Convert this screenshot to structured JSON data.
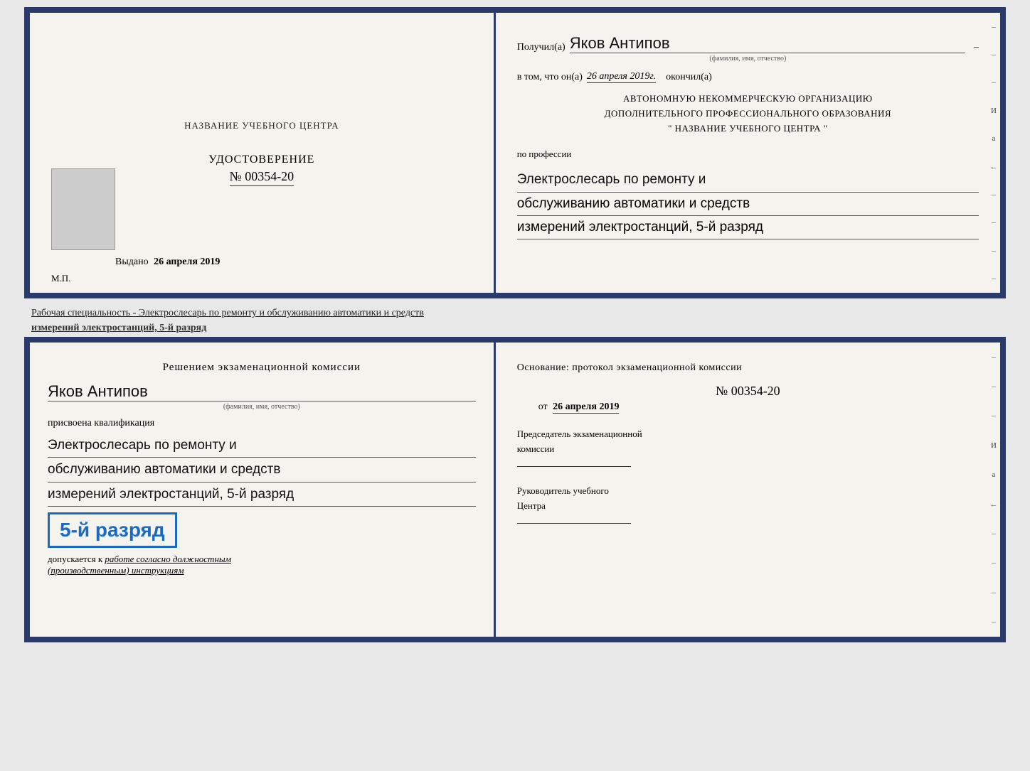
{
  "top_left": {
    "center_title": "НАЗВАНИЕ УЧЕБНОГО ЦЕНТРА",
    "udost_label": "УДОСТОВЕРЕНИЕ",
    "udost_number": "№ 00354-20",
    "vydano_label": "Выдано",
    "vydano_date": "26 апреля 2019",
    "mp": "М.П."
  },
  "top_right": {
    "poluchil_label": "Получил(а)",
    "recipient_name": "Яков Антипов",
    "fio_hint": "(фамилия, имя, отчество)",
    "vtom_label": "в том, что он(а)",
    "vtom_date": "26 апреля 2019г.",
    "okonchil_label": "окончил(а)",
    "org_line1": "АВТОНОМНУЮ НЕКОММЕРЧЕСКУЮ ОРГАНИЗАЦИЮ",
    "org_line2": "ДОПОЛНИТЕЛЬНОГО ПРОФЕССИОНАЛЬНОГО ОБРАЗОВАНИЯ",
    "org_line3": "\"  НАЗВАНИЕ УЧЕБНОГО ЦЕНТРА  \"",
    "po_professii": "по профессии",
    "profession_line1": "Электрослесарь по ремонту и",
    "profession_line2": "обслуживанию автоматики и средств",
    "profession_line3": "измерений электростанций, 5-й разряд"
  },
  "middle_text": {
    "line1": "Рабочая специальность - Электрослесарь по ремонту и обслуживанию автоматики и средств",
    "line2": "измерений электростанций, 5-й разряд"
  },
  "bottom_left": {
    "resheniem": "Решением экзаменационной комиссии",
    "name": "Яков Антипов",
    "fio_hint": "(фамилия, имя, отчество)",
    "prisvoena": "присвоена квалификация",
    "qual_line1": "Электрослесарь по ремонту и",
    "qual_line2": "обслуживанию автоматики и средств",
    "qual_line3": "измерений электростанций, 5-й разряд",
    "razryad_badge": "5-й разряд",
    "dopuskaetsya_label": "допускается к",
    "dopuskaetsya_value": "работе согласно должностным",
    "dopuskaetsya_value2": "(производственным) инструкциям"
  },
  "bottom_right": {
    "osnovanie_label": "Основание: протокол экзаменационной комиссии",
    "protocol_number": "№ 00354-20",
    "ot_label": "от",
    "ot_date": "26 апреля 2019",
    "predsedatel_label": "Председатель экзаменационной",
    "predsedatel_label2": "комиссии",
    "rukovoditel_label": "Руководитель учебного",
    "rukovoditel_label2": "Центра"
  },
  "right_dashes": [
    "–",
    "–",
    "–",
    "И",
    "а",
    "←",
    "–",
    "–",
    "–",
    "–",
    "–"
  ]
}
